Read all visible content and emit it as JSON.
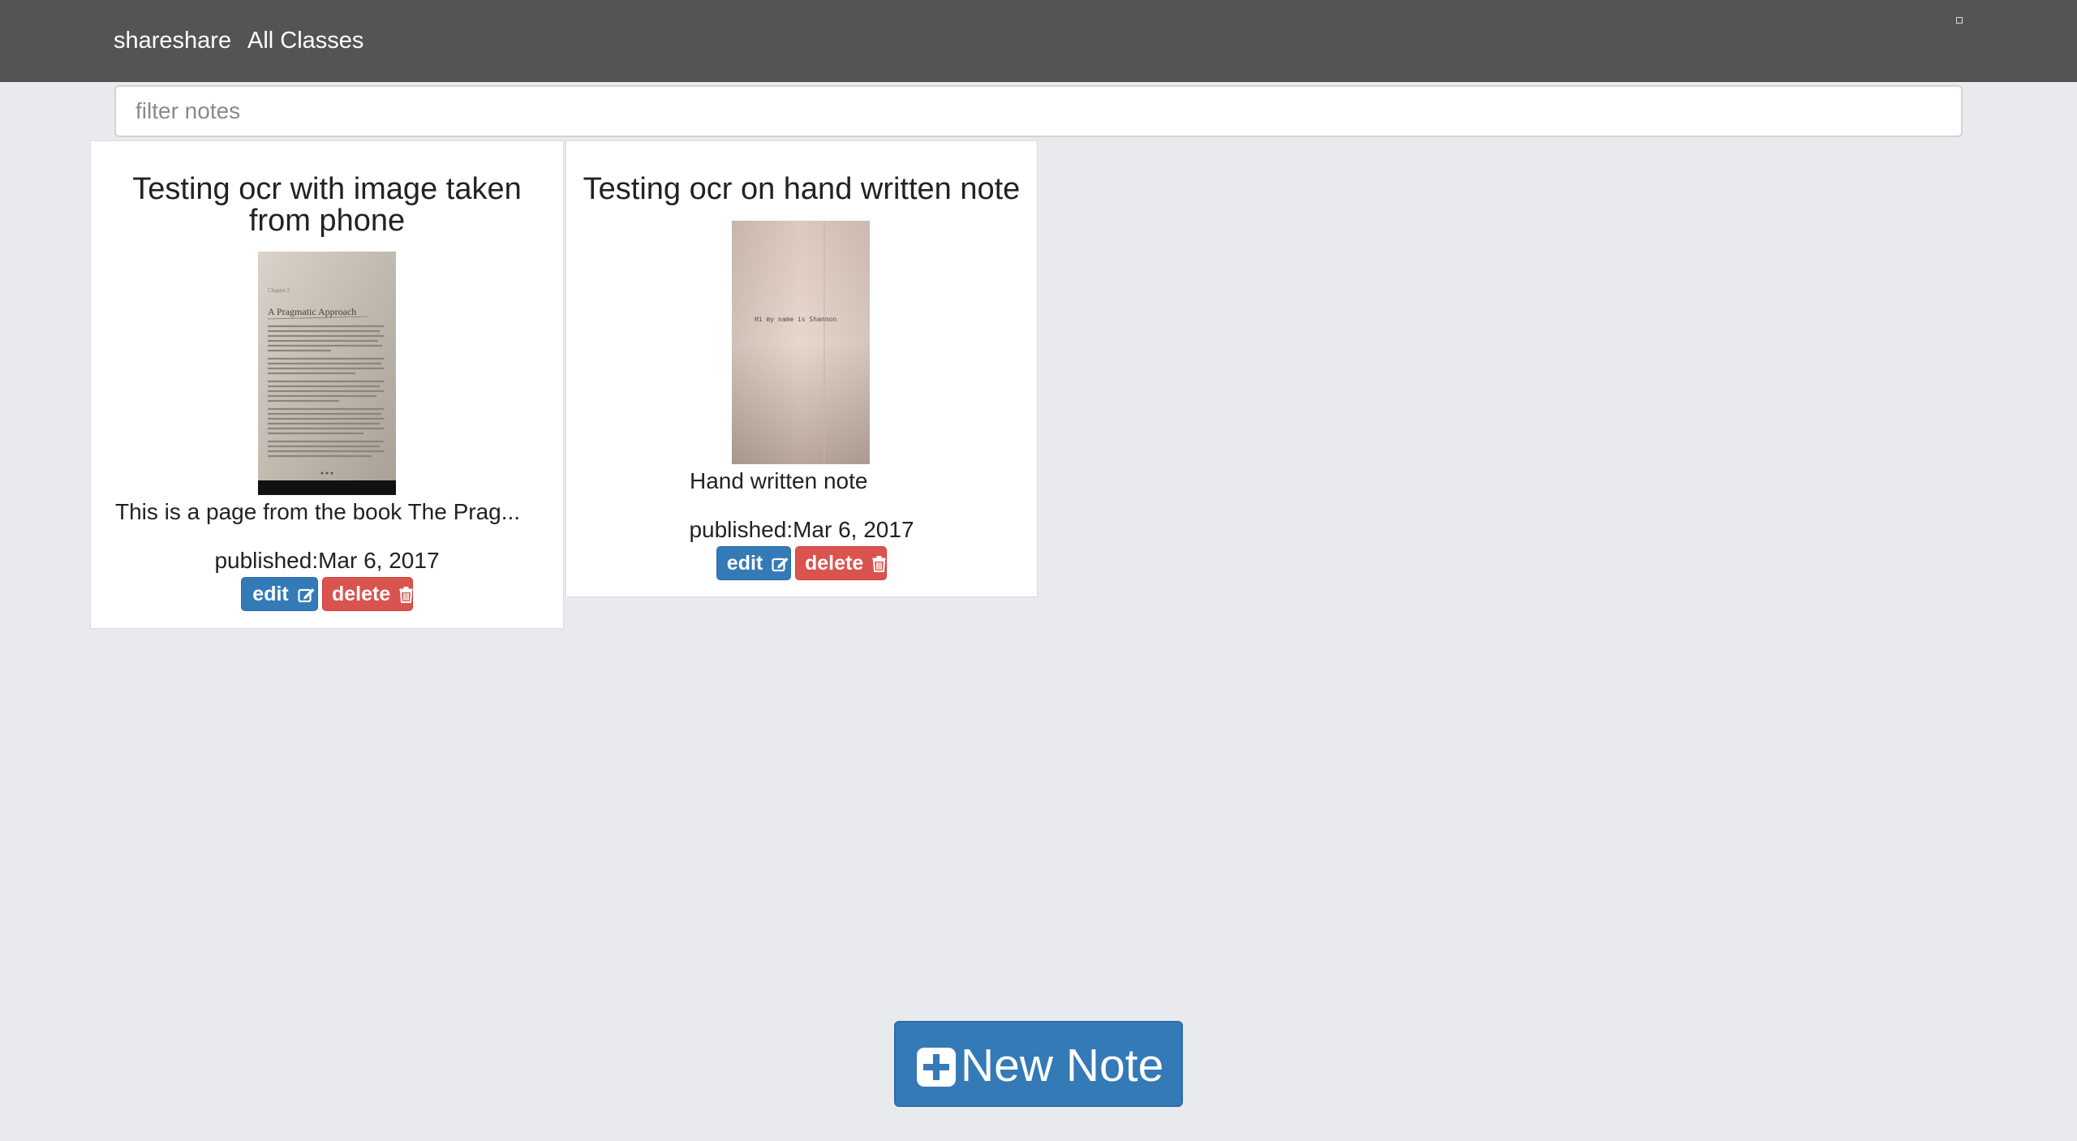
{
  "nav": {
    "brand": "shareshare",
    "all_classes": "All Classes"
  },
  "filter": {
    "placeholder": "filter notes",
    "value": ""
  },
  "notes": [
    {
      "title": "Testing ocr with image taken from phone",
      "description": "This is a page from the book The Prag...",
      "published": "published:Mar 6, 2017",
      "edit_label": "edit",
      "delete_label": "delete",
      "thumbnail": {
        "chapter": "Chapter 2",
        "heading": "A Pragmatic Approach"
      }
    },
    {
      "title": "Testing ocr on hand written note",
      "description": "Hand written note",
      "published": "published:Mar 6, 2017",
      "edit_label": "edit",
      "delete_label": "delete",
      "thumbnail": {
        "handwriting": "Hi my name is Shannon"
      }
    }
  ],
  "new_note": {
    "label": "New Note"
  },
  "colors": {
    "navbar": "#545454",
    "background": "#e9eaee",
    "primary": "#337ab7",
    "danger": "#d9534f"
  },
  "icons": {
    "edit": "edit-icon",
    "delete": "trash-icon",
    "new_note": "plus-square-icon"
  }
}
